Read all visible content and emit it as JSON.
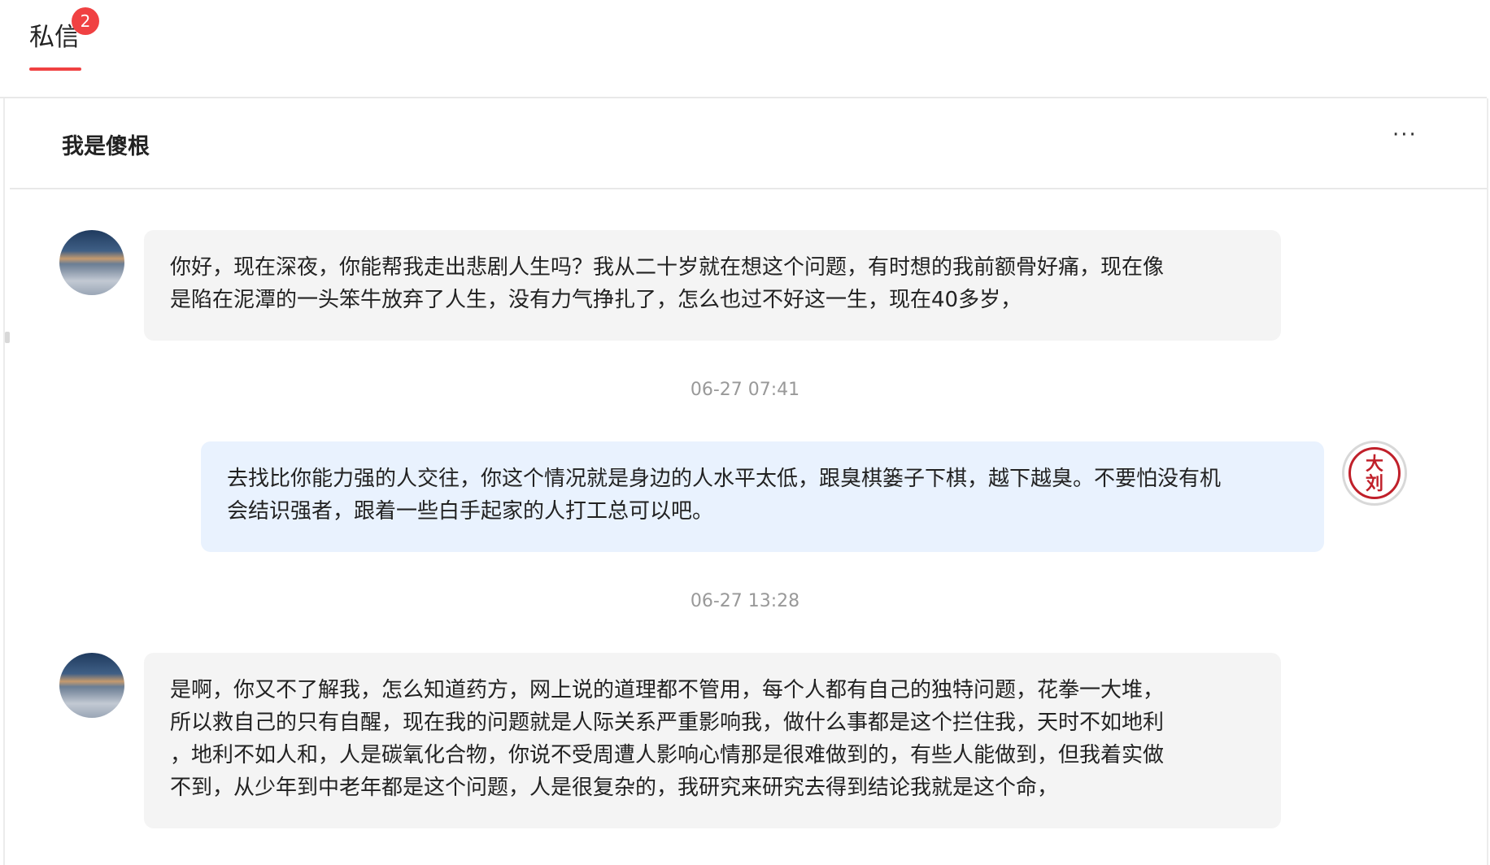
{
  "tabs": {
    "active_label": "私信",
    "unread_count": "2"
  },
  "chat": {
    "title": "我是傻根",
    "more_label": "···"
  },
  "messages": [
    {
      "side": "incoming",
      "lines": [
        "你好，现在深夜，你能帮我走出悲剧人生吗？我从二十岁就在想这个问题，有时想的我前额骨好痛，现在像",
        "是陷在泥潭的一头笨牛放弃了人生，没有力气挣扎了，怎么也过不好这一生，现在40多岁，"
      ]
    },
    {
      "side": "outgoing",
      "time": "06-27 07:41",
      "lines": [
        "去找比你能力强的人交往，你这个情况就是身边的人水平太低，跟臭棋篓子下棋，越下越臭。不要怕没有机",
        "会结识强者，跟着一些白手起家的人打工总可以吧。"
      ],
      "avatar_text": [
        "大",
        "刘"
      ]
    },
    {
      "side": "incoming",
      "time": "06-27 13:28",
      "lines": [
        "是啊，你又不了解我，怎么知道药方，网上说的道理都不管用，每个人都有自己的独特问题，花拳一大堆，",
        "所以救自己的只有自醒，现在我的问题就是人际关系严重影响我，做什么事都是这个拦住我，天时不如地利",
        "，地利不如人和，人是碳氧化合物，你说不受周遭人影响心情那是很难做到的，有些人能做到，但我着实做",
        "不到，从少年到中老年都是这个问题，人是很复杂的，我研究来研究去得到结论我就是这个命，"
      ]
    }
  ],
  "colors": {
    "accent": "#f04142",
    "incoming_bubble": "#f4f4f4",
    "outgoing_bubble": "#e9f2fe",
    "timestamp": "#999999",
    "seal": "#c0202a"
  }
}
